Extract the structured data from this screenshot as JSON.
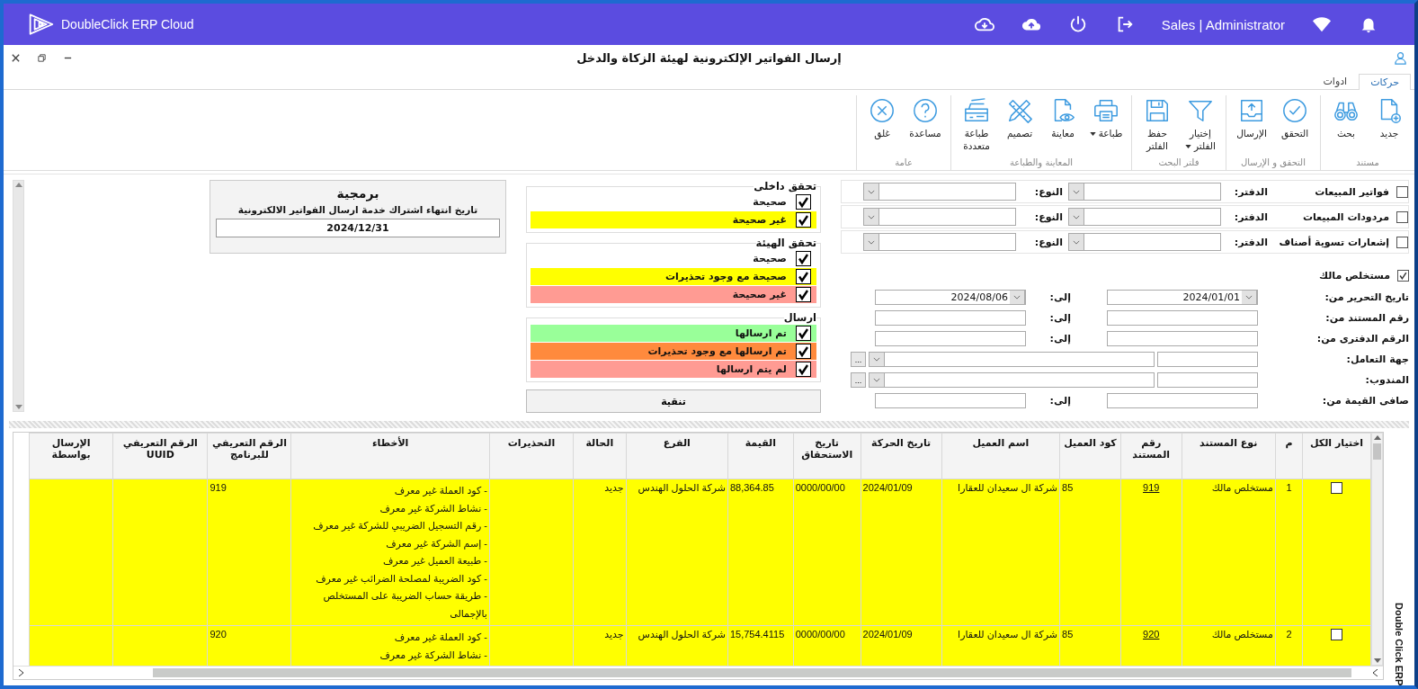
{
  "app_bar": {
    "brand": "DoubleClick ERP Cloud",
    "user": "Sales | Administrator"
  },
  "window": {
    "title": "إرسال الفواتير الإلكترونية لهيئة الزكاة والدخل"
  },
  "tabs": [
    {
      "label": "حركات",
      "selected": true
    },
    {
      "label": "ادوات",
      "selected": false
    }
  ],
  "ribbon": [
    {
      "title": "مستند",
      "buttons": [
        {
          "lines": [
            "جديد"
          ],
          "dropdown": false
        },
        {
          "lines": [
            "بحث"
          ],
          "dropdown": false
        }
      ]
    },
    {
      "title": "التحقق و الإرسال",
      "buttons": [
        {
          "lines": [
            "التحقق"
          ],
          "dropdown": false
        },
        {
          "lines": [
            "الإرسال"
          ],
          "dropdown": false
        }
      ]
    },
    {
      "title": "فلتر البحث",
      "buttons": [
        {
          "lines": [
            "إختيار",
            "الفلتر"
          ],
          "dropdown": true
        },
        {
          "lines": [
            "حفظ",
            "الفلتر"
          ],
          "dropdown": false
        }
      ]
    },
    {
      "title": "المعاينة والطباعة",
      "buttons": [
        {
          "lines": [
            "طباعة"
          ],
          "dropdown": true
        },
        {
          "lines": [
            "معاينة"
          ],
          "dropdown": false
        },
        {
          "lines": [
            "تصميم"
          ],
          "dropdown": false
        },
        {
          "lines": [
            "طباعة",
            "متعددة"
          ],
          "dropdown": false
        }
      ]
    },
    {
      "title": "عامة",
      "buttons": [
        {
          "lines": [
            "مساعدة"
          ],
          "dropdown": false
        },
        {
          "lines": [
            "غلق"
          ],
          "dropdown": false
        }
      ]
    }
  ],
  "doc_types": [
    {
      "kind": "book",
      "label": "فواتير المبيعات",
      "checked": false,
      "book_label": "الدفتر:",
      "type_label": "النوع:"
    },
    {
      "kind": "book",
      "label": "مردودات المبيعات",
      "checked": false,
      "book_label": "الدفتر:",
      "type_label": "النوع:"
    },
    {
      "kind": "book",
      "label": "إشعارات تسوية أصناف",
      "checked": false,
      "book_label": "الدفتر:",
      "type_label": "النوع:"
    },
    {
      "kind": "plain",
      "label": "مستخلص مالك",
      "checked": true
    }
  ],
  "range_fields": [
    {
      "kind": "date",
      "label": "تاريخ التحرير من:",
      "from": "2024/01/01",
      "to_label": "إلى:",
      "to": "2024/08/06"
    },
    {
      "kind": "range",
      "label": "رقم المستند من:",
      "to_label": "إلى:"
    },
    {
      "kind": "range",
      "label": "الرقم الدفترى من:",
      "to_label": "إلى:"
    },
    {
      "kind": "lookup",
      "label": "جهة التعامل:",
      "browse": "..."
    },
    {
      "kind": "lookup",
      "label": "المندوب:",
      "browse": "..."
    },
    {
      "kind": "range",
      "label": "صافى القيمة من:",
      "to_label": "إلى:"
    }
  ],
  "status_groups": [
    {
      "title": "تحقق داخلى",
      "items": [
        {
          "label": "صحيحة",
          "checked": true,
          "color": "#ffffff"
        },
        {
          "label": "غير صحيحة",
          "checked": true,
          "color": "#ffff00"
        }
      ]
    },
    {
      "title": "تحقق الهيئة",
      "items": [
        {
          "label": "صحيحة",
          "checked": true,
          "color": "#ffffff"
        },
        {
          "label": "صحيحة مع وجود تحذيرات",
          "checked": true,
          "color": "#ffff00"
        },
        {
          "label": "غير صحيحة",
          "checked": true,
          "color": "#ff9b93"
        }
      ]
    },
    {
      "title": "ارسال",
      "items": [
        {
          "label": "تم ارسالها",
          "checked": true,
          "color": "#99ff99"
        },
        {
          "label": "تم ارسالها مع وجود تحذيرات",
          "checked": true,
          "color": "#ff8a3d"
        },
        {
          "label": "لم يتم ارسالها",
          "checked": true,
          "color": "#ff9b93"
        }
      ]
    }
  ],
  "filter_button": "تنقية",
  "subscription": {
    "product": "برمجية",
    "label": "تاريخ انتهاء اشتراك خدمة ارسال الفواتير الالكترونية",
    "expiry": "2024/12/31"
  },
  "table": {
    "columns": [
      "اختيار الكل",
      "م",
      "نوع المستند",
      "رقم المستند",
      "كود العميل",
      "اسم العميل",
      "تاريخ الحركة",
      "تاريخ الاستحقاق",
      "القيمة",
      "الفرع",
      "الحالة",
      "التحذيرات",
      "الأخطاء",
      "الرقم التعريفي للبرنامج",
      "الرقم التعريفي UUID",
      "الإرسال بواسطة"
    ],
    "rows": [
      {
        "selected": false,
        "color": "#ffff00",
        "index": "1",
        "doc_type": "مستخلص مالك",
        "doc_no": "919",
        "customer_code": "85",
        "customer_name": "شركة ال سعيدان للعقارا",
        "move_date": "2024/01/09",
        "due_date": "0000/00/00",
        "amount": "88,364.85",
        "branch": "شركة الحلول الهندس",
        "status": "جديد",
        "errors": [
          "- كود العملة غير معرف",
          "- نشاط الشركة غير معرف",
          "- رقم التسجيل الضريبي للشركة غير معرف",
          "- إسم الشركة غير معرف",
          "- طبيعة العميل غير معرف",
          "- كود الضريبة لمصلحة الضرائب غير معرف",
          "- طريقة حساب الضريبة على المستخلص بالإجمالى"
        ],
        "program_id": "919"
      },
      {
        "selected": false,
        "color": "#ffff00",
        "index": "2",
        "doc_type": "مستخلص مالك",
        "doc_no": "920",
        "customer_code": "85",
        "customer_name": "شركة ال سعيدان للعقارا",
        "move_date": "2024/01/09",
        "due_date": "0000/00/00",
        "amount": "15,754.4115",
        "branch": "شركة الحلول الهندس",
        "status": "جديد",
        "errors": [
          "- كود العملة غير معرف",
          "- نشاط الشركة غير معرف"
        ],
        "program_id": "920"
      }
    ]
  },
  "side_tab": "Double Click ERP"
}
